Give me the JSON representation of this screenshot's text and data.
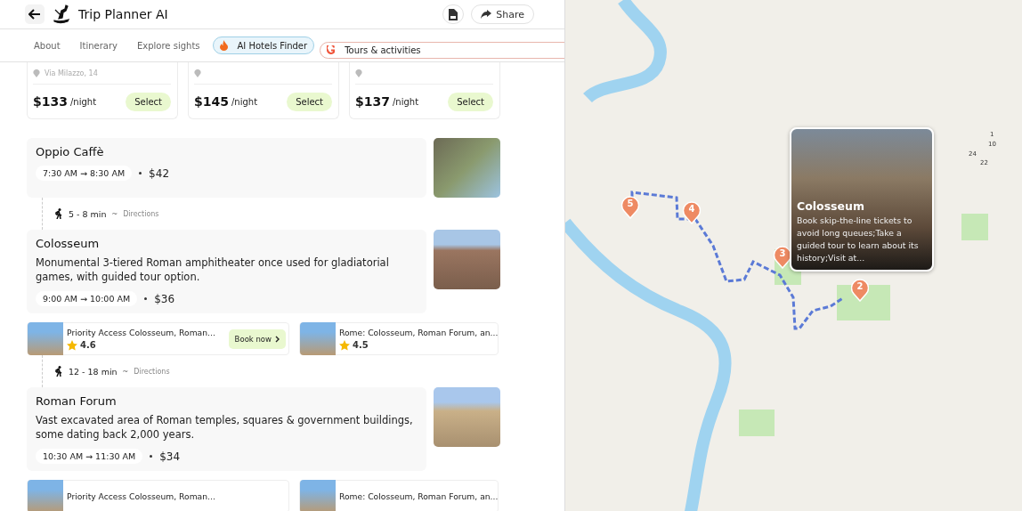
{
  "header": {
    "title": "Trip Planner AI",
    "share_label": "Share"
  },
  "tabs": [
    {
      "label": "About",
      "kind": "plain",
      "selected": false
    },
    {
      "label": "Itinerary",
      "kind": "plain",
      "selected": false
    },
    {
      "label": "Explore sights",
      "kind": "plain",
      "selected": false
    },
    {
      "label": "AI Hotels Finder",
      "kind": "hotels",
      "selected": true
    },
    {
      "label": "Tours & activities",
      "kind": "tours",
      "selected": false
    }
  ],
  "hotels": [
    {
      "address": "Via Milazzo, 14",
      "price": "$133",
      "unit": "/night",
      "button": "Select"
    },
    {
      "price": "$145",
      "unit": "/night",
      "button": "Select"
    },
    {
      "price": "$137",
      "unit": "/night",
      "button": "Select"
    }
  ],
  "stops": [
    {
      "name": "Oppio Caffè",
      "time": "7:30 AM → 8:30 AM",
      "price": "$42",
      "walk": {
        "duration": "5 - 8 min",
        "separator": "~",
        "link": "Directions"
      }
    },
    {
      "name": "Colosseum",
      "description": "Monumental 3-tiered Roman amphitheater once used for gladiatorial games, with guided tour option.",
      "time": "9:00 AM → 10:00 AM",
      "price": "$36",
      "tours": [
        {
          "title": "Priority Access Colosseum, Roman...",
          "rating": "4.6",
          "button": "Book now"
        },
        {
          "title": "Rome: Colosseum, Roman Forum, an...",
          "rating": "4.5"
        }
      ],
      "walk": {
        "duration": "12 - 18 min",
        "separator": "~",
        "link": "Directions"
      }
    },
    {
      "name": "Roman Forum",
      "description": "Vast excavated area of Roman temples, squares & government buildings, some dating back 2,000 years.",
      "time": "10:30 AM → 11:30 AM",
      "price": "$34",
      "tours": [
        {
          "title": "Priority Access Colosseum, Roman..."
        },
        {
          "title": "Rome: Colosseum, Roman Forum, an..."
        }
      ]
    }
  ],
  "map": {
    "markers": [
      {
        "label": "5"
      },
      {
        "label": "4"
      },
      {
        "label": "3"
      },
      {
        "label": "2"
      }
    ],
    "street_numbers": [
      "1",
      "10",
      "24",
      "22"
    ],
    "popup": {
      "title": "Colosseum",
      "text": "Book skip-the-line tickets to avoid long queues;Take a guided tour to learn about its history;Visit at..."
    }
  }
}
